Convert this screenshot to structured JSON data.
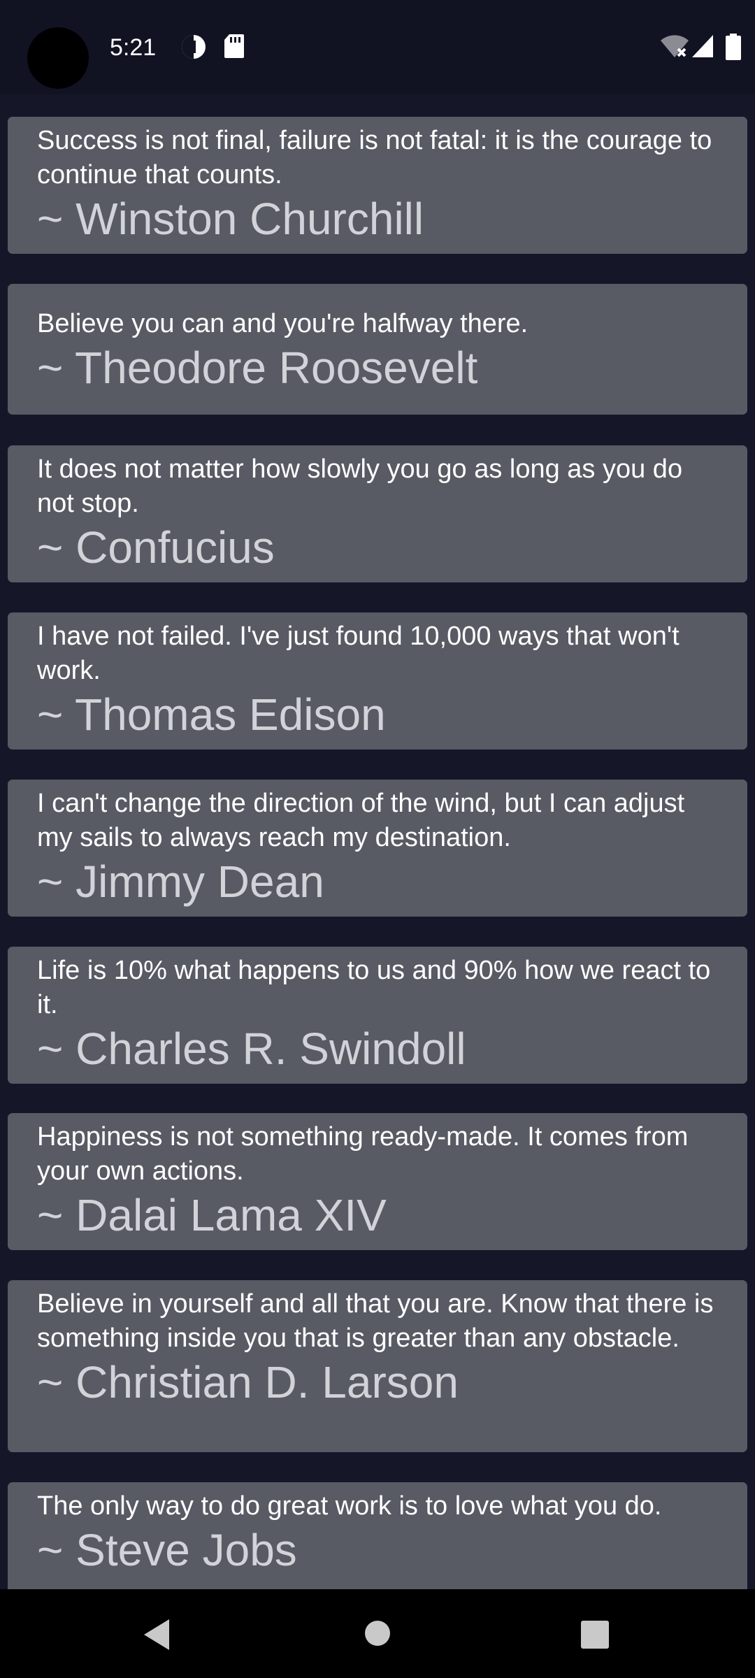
{
  "status_bar": {
    "time": "5:21",
    "icons": [
      "data-saver-icon",
      "sd-card-icon",
      "wifi-off-icon",
      "signal-icon",
      "battery-icon"
    ]
  },
  "quotes": [
    {
      "text": "Success is not final, failure is not fatal: it is the courage to continue that counts.",
      "author": "~ Winston Churchill"
    },
    {
      "text": "Believe you can and you're halfway there.",
      "author": "~ Theodore Roosevelt"
    },
    {
      "text": "It does not matter how slowly you go as long as you do not stop.",
      "author": "~ Confucius"
    },
    {
      "text": "I have not failed. I've just found 10,000 ways that won't work.",
      "author": "~ Thomas Edison"
    },
    {
      "text": "I can't change the direction of the wind, but I can adjust my sails to always reach my destination.",
      "author": "~ Jimmy Dean"
    },
    {
      "text": "Life is 10% what happens to us and 90% how we react to it.",
      "author": "~ Charles R. Swindoll"
    },
    {
      "text": "Happiness is not something ready-made. It comes from your own actions.",
      "author": "~ Dalai Lama XIV"
    },
    {
      "text": "Believe in yourself and all that you are. Know that there is something inside you that is greater than any obstacle.",
      "author": "~ Christian D. Larson"
    },
    {
      "text": "The only way to do great work is to love what you do.",
      "author": "~ Steve Jobs"
    }
  ],
  "colors": {
    "background": "#151729",
    "card": "#585a64",
    "quote_text": "#ffffff",
    "author_text": "#d2d3d8"
  },
  "nav_bar": {
    "icons": [
      "back-icon",
      "home-icon",
      "recents-icon"
    ]
  }
}
